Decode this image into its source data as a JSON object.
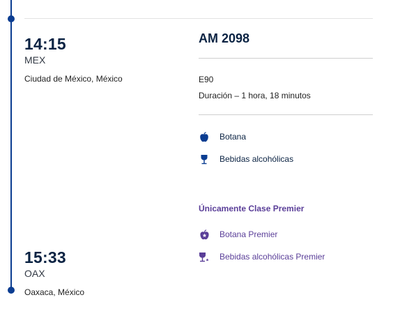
{
  "departure": {
    "time": "14:15",
    "code": "MEX",
    "city": "Ciudad de México, México"
  },
  "arrival": {
    "time": "15:33",
    "code": "OAX",
    "city": "Oaxaca, México"
  },
  "flight": {
    "number": "AM 2098",
    "aircraft": "E90",
    "duration": "Duración – 1 hora, 18 minutos"
  },
  "amenities": [
    {
      "icon": "apple-icon",
      "label": "Botana"
    },
    {
      "icon": "wine-glass-icon",
      "label": "Bebidas alcohólicas"
    }
  ],
  "premier": {
    "title": "Únicamente Clase Premier",
    "amenities": [
      {
        "icon": "premier-apple-icon",
        "label": "Botana Premier"
      },
      {
        "icon": "premier-wine-glass-icon",
        "label": "Bebidas alcohólicas Premier"
      }
    ]
  },
  "colors": {
    "navy": "#0b2343",
    "timeline": "#0b3d91",
    "premier": "#5a3e98"
  }
}
